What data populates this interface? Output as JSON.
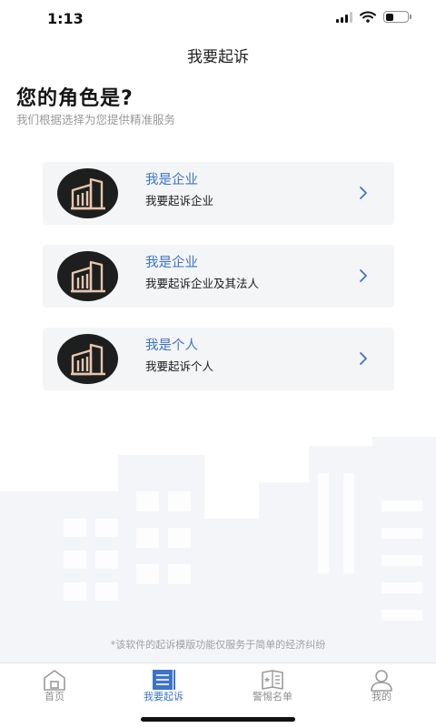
{
  "status_bar": {
    "time": "1:13",
    "signal_icon": "cellular-signal-icon",
    "wifi_icon": "wifi-icon",
    "battery_icon": "battery-icon",
    "battery_level": 0.35
  },
  "header": {
    "title": "我要起诉"
  },
  "intro": {
    "heading": "您的角色是?",
    "subheading": "我们根据选择为您提供精准服务"
  },
  "options": [
    {
      "title": "我是企业",
      "description": "我要起诉企业",
      "icon": "building-icon",
      "chevron": "chevron-right-icon"
    },
    {
      "title": "我是企业",
      "description": "我要起诉企业及其法人",
      "icon": "building-icon",
      "chevron": "chevron-right-icon"
    },
    {
      "title": "我是个人",
      "description": "我要起诉个人",
      "icon": "building-icon",
      "chevron": "chevron-right-icon"
    }
  ],
  "disclaimer": "*该软件的起诉模版功能仅服务于简单的经济纠纷",
  "tab_bar": {
    "tabs": [
      {
        "label": "首页",
        "icon": "home-icon",
        "active": false
      },
      {
        "label": "我要起诉",
        "icon": "document-list-icon",
        "active": true
      },
      {
        "label": "警惕名单",
        "icon": "warning-list-icon",
        "active": false
      },
      {
        "label": "我的",
        "icon": "user-icon",
        "active": false
      }
    ]
  },
  "colors": {
    "accent": "#3d74c7",
    "card_background": "#f4f5f7",
    "avatar_background": "#1d1f1f",
    "building_color": "#e6c6ae",
    "muted_text": "#9a9a9a"
  }
}
